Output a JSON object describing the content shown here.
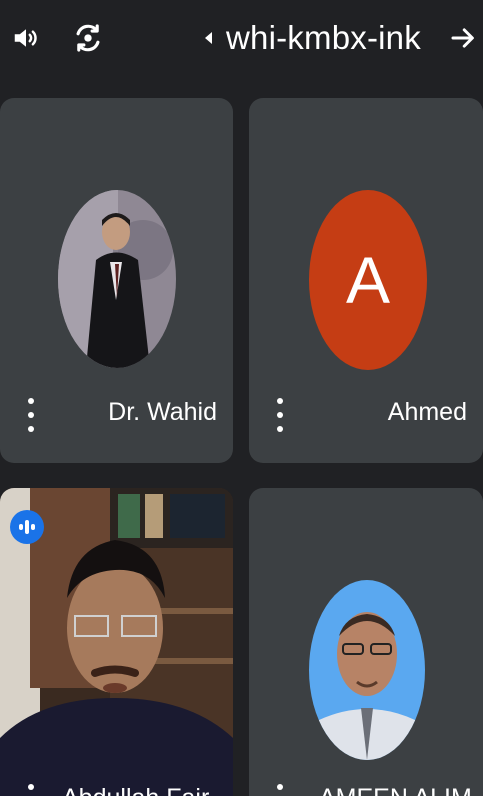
{
  "header": {
    "meeting_code": "whi-kmbx-ink",
    "audio_icon": "speaker-icon",
    "switch_camera_icon": "switch-camera-icon",
    "forward_icon": "arrow-right-icon"
  },
  "participants": [
    {
      "name": "Dr. Wahid",
      "avatar_type": "photo"
    },
    {
      "name": "Ahmed",
      "avatar_type": "initial",
      "initial": "A",
      "avatar_color": "#c53d14"
    },
    {
      "name": "Abdullah Fair...",
      "avatar_type": "video",
      "speaking": true
    },
    {
      "name": "AMEEN ALIM...",
      "avatar_type": "photo"
    }
  ],
  "colors": {
    "background": "#202124",
    "tile": "#3c4043",
    "speaking_badge": "#1a73e8"
  }
}
